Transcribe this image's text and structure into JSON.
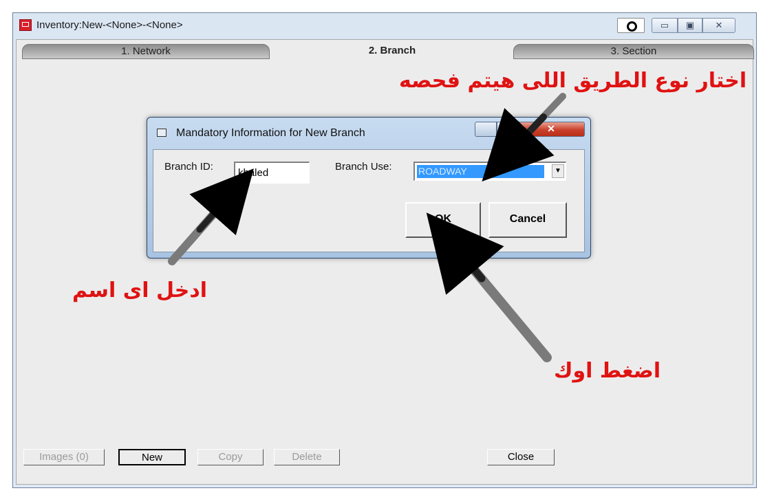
{
  "window": {
    "title": "Inventory:New-<None>-<None>"
  },
  "tabs": [
    {
      "label": "1. Network",
      "active": false
    },
    {
      "label": "2. Branch",
      "active": true
    },
    {
      "label": "3. Section",
      "active": false
    }
  ],
  "dialog": {
    "title": "Mandatory Information for New Branch",
    "branch_id_label": "Branch ID:",
    "branch_id_value": "khaled",
    "branch_use_label": "Branch Use:",
    "branch_use_value": "ROADWAY",
    "ok_label": "OK",
    "cancel_label": "Cancel"
  },
  "annotations": {
    "choose_road_type": "اختار نوع الطريق اللى هيتم فحصه",
    "enter_name": "ادخل اى اسم",
    "press_ok": "اضغط اوك",
    "color": "#e01212"
  },
  "bottom_buttons": {
    "images": "Images (0)",
    "new": "New",
    "copy": "Copy",
    "delete": "Delete",
    "close": "Close"
  }
}
